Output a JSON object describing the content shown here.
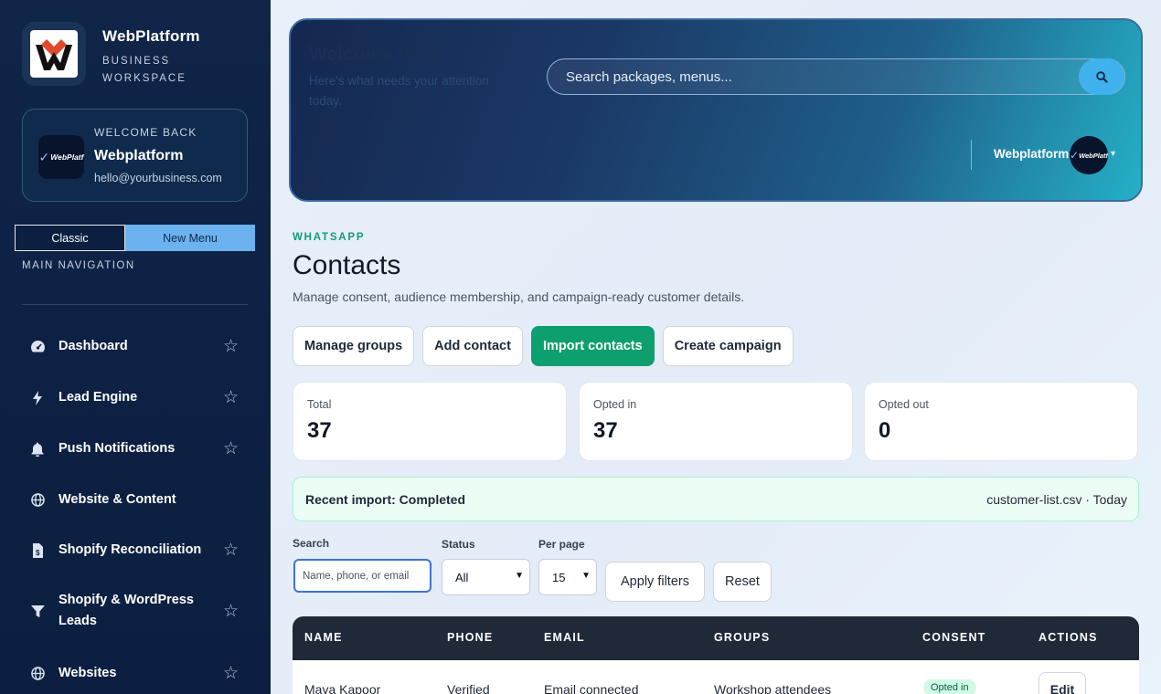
{
  "brand": {
    "title": "WebPlatform",
    "subtitle_line1": "BUSINESS",
    "subtitle_line2": "WORKSPACE",
    "logo_icon": "webplatform-logo"
  },
  "user_card": {
    "welcome": "WELCOME BACK",
    "name": "Webplatform",
    "email": "hello@yourbusiness.com",
    "avatar_text": "WebPlatf"
  },
  "menu_toggle": {
    "classic": "Classic",
    "new_menu": "New Menu",
    "active": "New Menu"
  },
  "nav": {
    "heading": "MAIN NAVIGATION",
    "items": [
      {
        "label": "Dashboard",
        "icon": "gauge-icon",
        "starred": true
      },
      {
        "label": "Lead Engine",
        "icon": "bolt-icon",
        "starred": true
      },
      {
        "label": "Push Notifications",
        "icon": "bell-icon",
        "starred": true
      },
      {
        "label": "Website & Content",
        "icon": "globe-icon",
        "starred": false
      },
      {
        "label": "Shopify Reconciliation",
        "icon": "file-dollar-icon",
        "starred": true
      },
      {
        "label": "Shopify & WordPress Leads",
        "icon": "filter-icon",
        "starred": true
      },
      {
        "label": "Websites",
        "icon": "globe-icon",
        "starred": true
      }
    ]
  },
  "hero": {
    "title": "Welcome back",
    "subtitle": "Here's what needs your attention today.",
    "search_placeholder": "Search packages, menus...",
    "user_name": "Webplatform",
    "avatar_text": "WebPlatf"
  },
  "page": {
    "eyebrow": "WHATSAPP",
    "title": "Contacts",
    "description": "Manage consent, audience membership, and campaign-ready customer details."
  },
  "actions": {
    "manage_groups": "Manage groups",
    "add_contact": "Add contact",
    "import_contacts": "Import contacts",
    "create_campaign": "Create campaign"
  },
  "stats": [
    {
      "label": "Total",
      "value": "37"
    },
    {
      "label": "Opted in",
      "value": "37"
    },
    {
      "label": "Opted out",
      "value": "0"
    }
  ],
  "import": {
    "status": "Recent import: Completed",
    "file": "customer-list.csv · Today"
  },
  "filters": {
    "search_label": "Search",
    "search_placeholder": "Name, phone, or email",
    "status_label": "Status",
    "status_value": "All",
    "per_page_label": "Per page",
    "per_page_value": "15",
    "apply": "Apply filters",
    "reset": "Reset"
  },
  "table": {
    "columns": [
      "NAME",
      "PHONE",
      "EMAIL",
      "GROUPS",
      "CONSENT",
      "ACTIONS"
    ],
    "rows": [
      {
        "name": "Maya Kapoor",
        "phone": "Verified",
        "email": "Email connected",
        "groups": "Workshop attendees",
        "consent": "Opted in",
        "action": "Edit"
      }
    ]
  },
  "colors": {
    "accent_green": "#0e9f6e",
    "sidebar_bg": "#0f2547",
    "toggle_active": "#6cb2ee",
    "search_button": "#3fb2ee"
  }
}
